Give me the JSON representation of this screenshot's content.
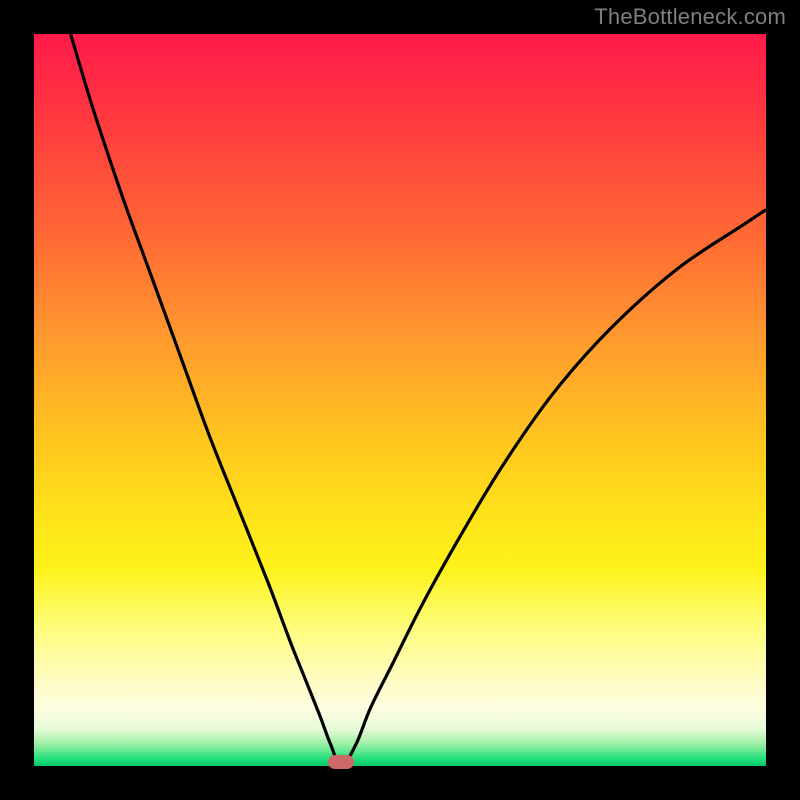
{
  "watermark": "TheBottleneck.com",
  "colors": {
    "frame": "#000000",
    "gradient_top": "#ff1a4b",
    "gradient_bottom": "#05c96b",
    "curve": "#000000",
    "marker": "#cc6a6a",
    "watermark_text": "#7f7f7f"
  },
  "chart_data": {
    "type": "line",
    "title": "",
    "xlabel": "",
    "ylabel": "",
    "xlim": [
      0,
      100
    ],
    "ylim": [
      0,
      100
    ],
    "grid": false,
    "legend": false,
    "annotations": [
      "TheBottleneck.com"
    ],
    "marker": {
      "x": 42,
      "y": 0
    },
    "series": [
      {
        "name": "curve",
        "x": [
          5,
          8,
          12,
          16,
          20,
          24,
          28,
          32,
          35,
          37,
          39,
          40.5,
          42,
          44,
          46,
          49,
          53,
          58,
          64,
          71,
          79,
          88,
          97,
          100
        ],
        "y": [
          100,
          90,
          78,
          67,
          56,
          45,
          35,
          25,
          17,
          12,
          7,
          3,
          0,
          3,
          8,
          14,
          22,
          31,
          41,
          51,
          60,
          68,
          74,
          76
        ]
      }
    ]
  }
}
